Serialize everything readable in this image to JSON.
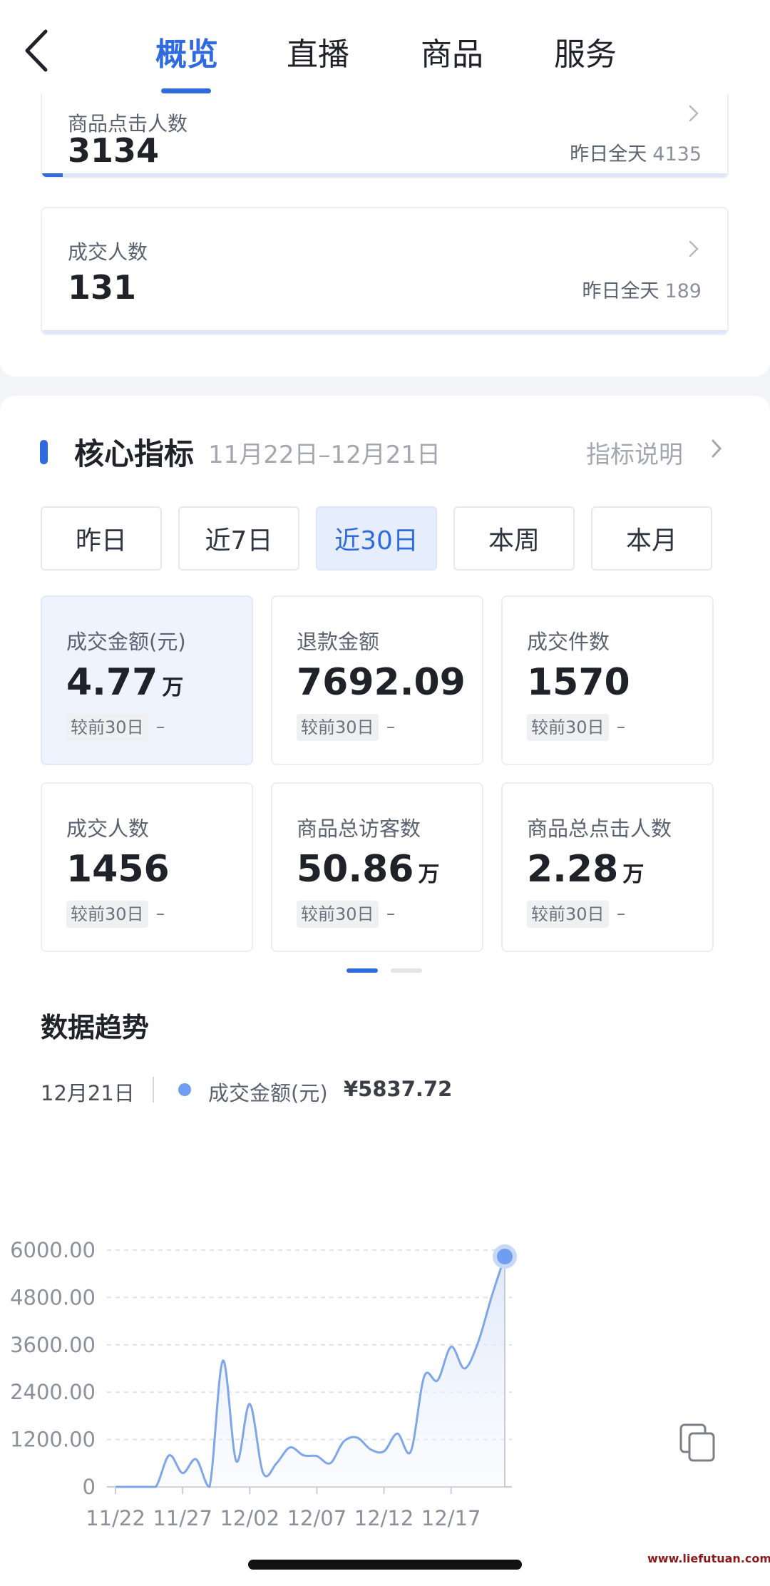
{
  "header": {
    "tabs": [
      {
        "label": "概览",
        "active": true
      },
      {
        "label": "直播",
        "active": false
      },
      {
        "label": "商品",
        "active": false
      },
      {
        "label": "服务",
        "active": false
      }
    ]
  },
  "top_metrics": [
    {
      "label": "商品点击人数",
      "value": "3134",
      "yesterday_label": "昨日全天",
      "yesterday_value": "4135",
      "progress": 0.03
    },
    {
      "label": "成交人数",
      "value": "131",
      "yesterday_label": "昨日全天",
      "yesterday_value": "189",
      "progress": 0.0
    }
  ],
  "core": {
    "title": "核心指标",
    "range": "11月22日–12月21日",
    "link": "指标说明",
    "ranges": [
      {
        "label": "昨日",
        "active": false
      },
      {
        "label": "近7日",
        "active": false
      },
      {
        "label": "近30日",
        "active": true
      },
      {
        "label": "本周",
        "active": false
      },
      {
        "label": "本月",
        "active": false
      }
    ],
    "kpis": [
      {
        "label": "成交金额(元)",
        "value": "4.77",
        "unit": "万",
        "compare": "较前30日",
        "change": "–",
        "active": true
      },
      {
        "label": "退款金额",
        "value": "7692.09",
        "unit": "",
        "compare": "较前30日",
        "change": "–",
        "active": false
      },
      {
        "label": "成交件数",
        "value": "1570",
        "unit": "",
        "compare": "较前30日",
        "change": "–",
        "active": false
      },
      {
        "label": "成交人数",
        "value": "1456",
        "unit": "",
        "compare": "较前30日",
        "change": "–",
        "active": false
      },
      {
        "label": "商品总访客数",
        "value": "50.86",
        "unit": "万",
        "compare": "较前30日",
        "change": "–",
        "active": false
      },
      {
        "label": "商品总点击人数",
        "value": "2.28",
        "unit": "万",
        "compare": "较前30日",
        "change": "–",
        "active": false
      }
    ],
    "page_indicator": {
      "pages": 2,
      "current": 1
    }
  },
  "trend": {
    "title": "数据趋势",
    "date": "12月21日",
    "series_label": "成交金额(元)",
    "amount": "¥5837.72",
    "accent_color": "#6f9ef0"
  },
  "chart_data": {
    "type": "area",
    "series": [
      {
        "name": "成交金额(元)",
        "values": [
          0,
          0,
          0,
          0,
          800,
          350,
          700,
          0,
          3200,
          650,
          2100,
          350,
          600,
          1000,
          800,
          780,
          600,
          1150,
          1250,
          950,
          900,
          1350,
          900,
          2800,
          2700,
          3550,
          3000,
          3650,
          4800,
          5837.72
        ]
      }
    ],
    "x_tick_labels": [
      "11/22",
      "11/27",
      "12/02",
      "12/07",
      "12/12",
      "12/17"
    ],
    "y_tick_labels": [
      "0",
      "1200.00",
      "2400.00",
      "3600.00",
      "4800.00",
      "6000.00"
    ],
    "ylim": [
      0,
      6000
    ],
    "grid": true,
    "color": "#7fa6e8"
  },
  "icons": {
    "back": "chevron-left-icon",
    "chevron": "chevron-right-icon",
    "copy": "copy-icon"
  },
  "watermark": "www.liefutuan.com"
}
